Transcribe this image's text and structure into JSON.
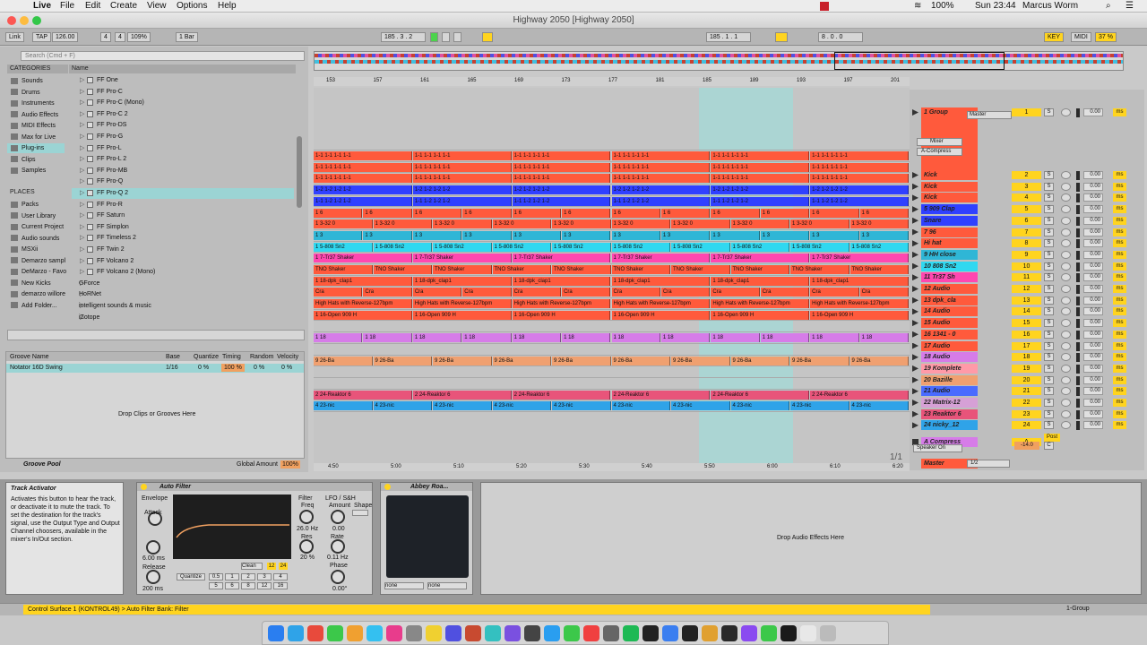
{
  "menubar": {
    "app": "Live",
    "items": [
      "File",
      "Edit",
      "Create",
      "View",
      "Options",
      "Help"
    ],
    "battery": "100%",
    "clock": "Sun 23:44",
    "user": "Marcus Worm"
  },
  "window": {
    "title": "Highway 2050  [Highway 2050]"
  },
  "control": {
    "link": "Link",
    "tap": "TAP",
    "tempo": "126.00",
    "sig_num": "4",
    "sig_den": "4",
    "zoom": "109%",
    "quant": "1 Bar",
    "pos": "185 .  3 .  2",
    "loop_start": "185 .  1 .  1",
    "loop_len": "8 .  0 .  0",
    "key": "KEY",
    "midi": "MIDI",
    "cpu": "37 %"
  },
  "browser": {
    "search_placeholder": "Search (Cmd + F)",
    "categories_title": "CATEGORIES",
    "name_col": "Name",
    "categories": [
      "Sounds",
      "Drums",
      "Instruments",
      "Audio Effects",
      "MIDI Effects",
      "Max for Live",
      "Plug-ins",
      "Clips",
      "Samples"
    ],
    "places_title": "PLACES",
    "places": [
      "Packs",
      "User Library",
      "Current Project",
      "Audio sounds",
      "MSXii",
      "Demarzo sampl",
      "DeMarzo - Favo",
      "New Kicks",
      "demarzo willore",
      "Add Folder..."
    ],
    "files": [
      "FF One",
      "FF Pro-C",
      "FF Pro-C (Mono)",
      "FF Pro-C 2",
      "FF Pro-DS",
      "FF Pro-G",
      "FF Pro-L",
      "FF Pro-L 2",
      "FF Pro-MB",
      "FF Pro-Q",
      "FF Pro-Q 2",
      "FF Pro-R",
      "FF Saturn",
      "FF Simplon",
      "FF Timeless 2",
      "FF Twin 2",
      "FF Volcano 2",
      "FF Volcano 2 (Mono)",
      "GForce",
      "HoRNet",
      "intelligent sounds & music",
      "iZotope"
    ]
  },
  "groove": {
    "cols": [
      "Groove Name",
      "Base",
      "Quantize",
      "Timing",
      "Random",
      "Velocity"
    ],
    "row": {
      "name": "Notator 16D Swing",
      "base": "1/16",
      "quantize": "0 %",
      "timing": "100 %",
      "random": "0 %",
      "velocity": "0 %"
    },
    "drop": "Drop Clips or Grooves Here",
    "pool": "Groove Pool",
    "global": "Global Amount",
    "global_val": "100%"
  },
  "ruler": {
    "bars": [
      "153",
      "157",
      "161",
      "165",
      "169",
      "173",
      "177",
      "181",
      "185",
      "189",
      "193",
      "197",
      "201"
    ],
    "times": [
      "4:50",
      "5:00",
      "5:10",
      "5:20",
      "5:30",
      "5:40",
      "5:50",
      "6:00",
      "6:10",
      "6:20"
    ]
  },
  "tracks": [
    {
      "name": "1 Group",
      "num": "1",
      "color": "#ff5a3c",
      "clip": "",
      "tall": true
    },
    {
      "name": "Kick",
      "num": "2",
      "color": "#ff5a3c",
      "clip": "1-1 1-1 1-1 1-1"
    },
    {
      "name": "Kick",
      "num": "3",
      "color": "#ff5a3c",
      "clip": "1-1 1-1 1-1 1-1"
    },
    {
      "name": "Kick",
      "num": "4",
      "color": "#ff5a3c",
      "clip": "1-1 1-1 1-1 1-1"
    },
    {
      "name": "5 909 Clap",
      "num": "5",
      "color": "#3040ff",
      "clip": "1-2 1-2 1-2 1-2"
    },
    {
      "name": "Snare",
      "num": "6",
      "color": "#3040ff",
      "clip": "1-1 1-2 1-2 1-2"
    },
    {
      "name": "7 96",
      "num": "7",
      "color": "#ff5a3c",
      "clip": "1 6"
    },
    {
      "name": "Hi hat",
      "num": "8",
      "color": "#ff5a3c",
      "clip": "1 3-32 0"
    },
    {
      "name": "9 HH close",
      "num": "9",
      "color": "#2fb6d6",
      "clip": "1 3"
    },
    {
      "name": "10 808 Sn2",
      "num": "10",
      "color": "#30d8f0",
      "clip": "1 5-808 Sn2"
    },
    {
      "name": "11 Tr37 Sh",
      "num": "11",
      "color": "#ff47b0",
      "clip": "1 7-Tr37 Shaker"
    },
    {
      "name": "12 Audio",
      "num": "12",
      "color": "#ff5a3c",
      "clip": "TNO Shaker"
    },
    {
      "name": "13 dpk_cla",
      "num": "13",
      "color": "#ff5a3c",
      "clip": "1 18-dpk_clap1"
    },
    {
      "name": "14 Audio",
      "num": "14",
      "color": "#ff5a3c",
      "clip": "Cra"
    },
    {
      "name": "15 Audio",
      "num": "15",
      "color": "#ff5a3c",
      "clip": "High Hats with Reverse-127bpm"
    },
    {
      "name": "16 1341 - 0",
      "num": "16",
      "color": "#ff5a3c",
      "clip": "1 16-Open 909 H"
    },
    {
      "name": "17 Audio",
      "num": "17",
      "color": "#ff5a3c",
      "clip": ""
    },
    {
      "name": "18 Audio",
      "num": "18",
      "color": "#d67ce8",
      "clip": "1 18"
    },
    {
      "name": "19 Komplete",
      "num": "19",
      "color": "#ff9aa8",
      "clip": ""
    },
    {
      "name": "20 Bazille",
      "num": "20",
      "color": "#f0a070",
      "clip": "9 26-Ba"
    },
    {
      "name": "21 Audio",
      "num": "21",
      "color": "#4a6bff",
      "clip": ""
    },
    {
      "name": "22 Matrix-12",
      "num": "22",
      "color": "#d6a0d6",
      "clip": ""
    },
    {
      "name": "23 Reaktor 6",
      "num": "23",
      "color": "#e8547a",
      "clip": "2 24-Reaktor 6"
    },
    {
      "name": "24 nicky_12",
      "num": "24",
      "color": "#2fa3e8",
      "clip": "4 23-nic"
    }
  ],
  "returns": [
    {
      "name": "A Compress",
      "num": "A"
    }
  ],
  "master": {
    "name": "Master",
    "val": "1/2"
  },
  "mixer": {
    "output": "Master",
    "mixer_label": "Mixer",
    "compress_label": "A-Compress",
    "speaker": "Speaker On",
    "vol": "0.00",
    "ms": "ms",
    "send_val": "-14.0",
    "c": "C",
    "post": "Post"
  },
  "info": {
    "title": "Track Activator",
    "text": "Activates this button to hear the track, or deactivate it to mute the track. To set the destination for the track's signal, use the Output Type and Output Channel choosers, available in the mixer's In/Out section."
  },
  "autofilter": {
    "title": "Auto Filter",
    "envelope": "Envelope",
    "attack": "Attack",
    "attack_val": "6.00 ms",
    "release": "Release",
    "release_val": "200 ms",
    "filter": "Filter",
    "freq": "Freq",
    "freq_val": "26.0 Hz",
    "res": "Res",
    "res_val": "20 %",
    "lfo": "LFO / S&H",
    "amount": "Amount",
    "amount_val": "0.00",
    "shape": "Shape",
    "rate": "Rate",
    "rate_val": "0.11 Hz",
    "phase": "Phase",
    "phase_val": "0.00°",
    "quantize": "Quantize",
    "clean": "Clean",
    "q_vals": [
      "0.5",
      "1",
      "2",
      "3",
      "4",
      "5",
      "6",
      "8",
      "12",
      "16"
    ],
    "v24": "24",
    "v12": "12"
  },
  "abbey": {
    "title": "Abbey Roa...",
    "none1": "none",
    "none2": "none"
  },
  "drop_fx": "Drop Audio Effects Here",
  "status": {
    "text": "Control Surface 1 (KONTROL49) > Auto Filter Bank: Filter",
    "group": "1-Group"
  },
  "colors": {
    "yellow": "#ffd41f",
    "loop": "#9fdcd8",
    "red": "#ff5a3c"
  }
}
